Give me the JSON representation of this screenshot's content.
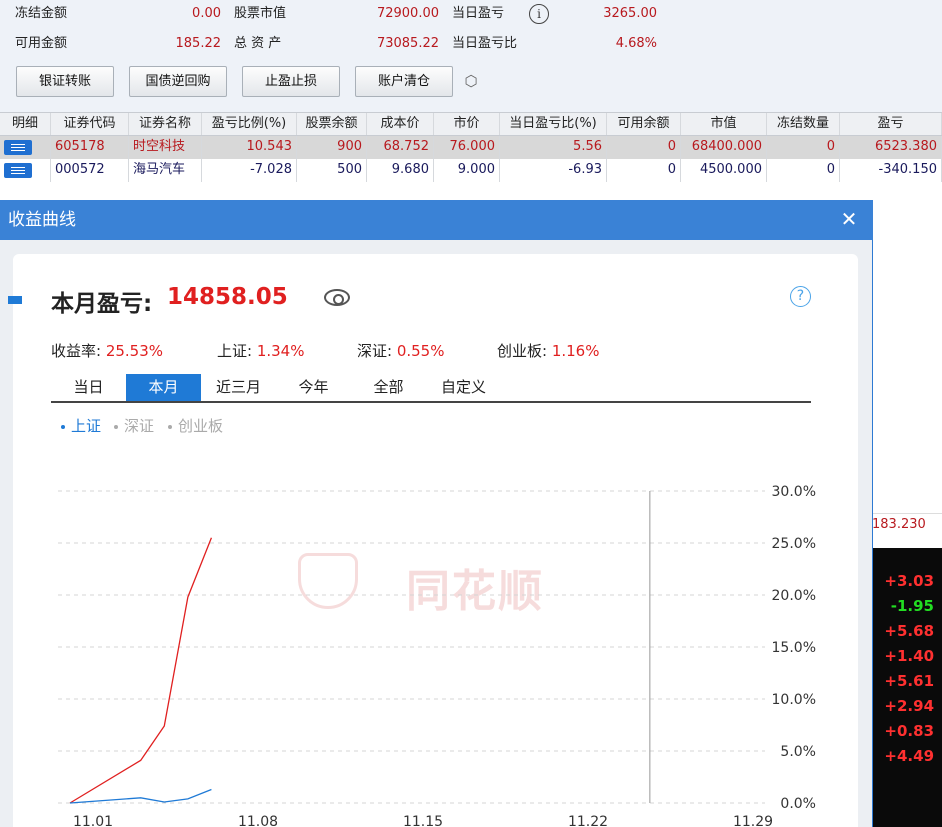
{
  "summary": {
    "row1": [
      {
        "label": "冻结金额",
        "value": "0.00"
      },
      {
        "label": "股票市值",
        "value": "72900.00"
      },
      {
        "label": "当日盈亏",
        "value": "3265.00"
      }
    ],
    "row2": [
      {
        "label": "可用金额",
        "value": "185.22"
      },
      {
        "label": "总 资 产",
        "value": "73085.22"
      },
      {
        "label": "当日盈亏比",
        "value": "4.68%"
      }
    ],
    "info_icon": "info-icon",
    "buttons": [
      "银证转账",
      "国债逆回购",
      "止盈止损",
      "账户清仓"
    ],
    "settings_icon": "gear-icon"
  },
  "table": {
    "headers": [
      "明细",
      "证券代码",
      "证券名称",
      "盈亏比例(%)",
      "股票余额",
      "成本价",
      "市价",
      "当日盈亏比(%)",
      "可用余额",
      "市值",
      "冻结数量",
      "盈亏"
    ],
    "rows": [
      [
        "",
        "605178",
        "时空科技",
        "10.543",
        "900",
        "68.752",
        "76.000",
        "5.56",
        "0",
        "68400.000",
        "0",
        "6523.380"
      ],
      [
        "",
        "000572",
        "海马汽车",
        "-7.028",
        "500",
        "9.680",
        "9.000",
        "-6.93",
        "0",
        "4500.000",
        "0",
        "-340.150"
      ]
    ],
    "total_pnl": "183.230"
  },
  "quotes": [
    "+3.03",
    "-1.95",
    "+5.68",
    "+1.40",
    "+5.61",
    "+2.94",
    "+0.83",
    "+4.49"
  ],
  "quote_colors": {
    "up": "#ff3030",
    "down": "#22dd22"
  },
  "dialog": {
    "title": "收益曲线",
    "close_icon": "close-icon",
    "month_label": "本月盈亏:",
    "month_value": "14858.05",
    "eye_icon": "eye-icon",
    "help_icon": "help-icon",
    "stats": [
      {
        "label": "收益率: ",
        "value": "25.53%"
      },
      {
        "label": "上证: ",
        "value": "1.34%"
      },
      {
        "label": "深证: ",
        "value": "0.55%"
      },
      {
        "label": "创业板: ",
        "value": "1.16%"
      }
    ],
    "tabs": [
      "当日",
      "本月",
      "近三月",
      "今年",
      "全部",
      "自定义"
    ],
    "active_tab": "本月",
    "legend": [
      {
        "label": "上证",
        "color": "#1f7ad6"
      },
      {
        "label": "深证",
        "color": "#aaaaaa"
      },
      {
        "label": "创业板",
        "color": "#aaaaaa"
      }
    ],
    "watermark": "同花顺"
  },
  "chart_data": {
    "type": "line",
    "x_ticks": [
      "11.01",
      "11.08",
      "11.15",
      "11.22",
      "11.29"
    ],
    "y_ticks": [
      "30.0%",
      "25.0%",
      "20.0%",
      "15.0%",
      "10.0%",
      "5.0%",
      "0.0%"
    ],
    "ylim": [
      0,
      30
    ],
    "xlim": [
      1,
      29
    ],
    "series": [
      {
        "color": "#e02020",
        "x": [
          1,
          4,
          5,
          6,
          7
        ],
        "y": [
          0,
          4.1,
          7.4,
          19.8,
          25.5
        ]
      },
      {
        "color": "#1f7ad6",
        "x": [
          1,
          4,
          5,
          6,
          7
        ],
        "y": [
          0,
          0.5,
          0.1,
          0.4,
          1.3
        ]
      }
    ],
    "marker_x": 25.6,
    "grid": true
  }
}
